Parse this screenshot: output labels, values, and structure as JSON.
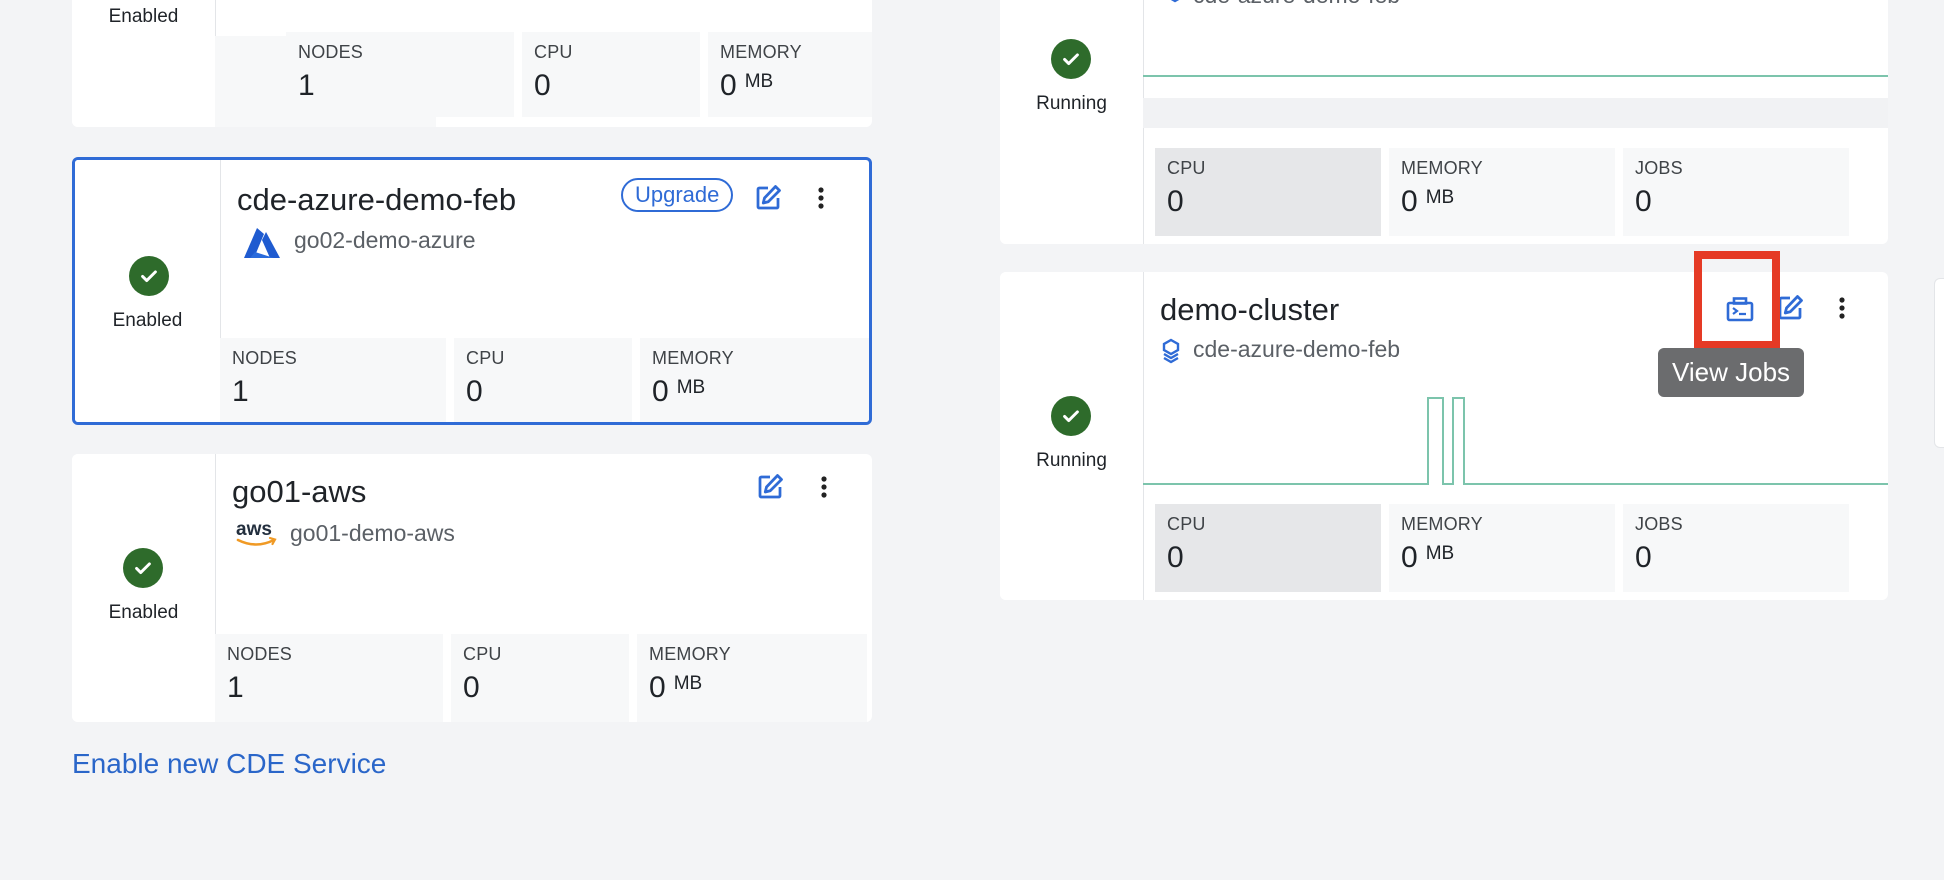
{
  "left_services": [
    {
      "status": "Enabled",
      "metrics": [
        {
          "label": "NODES",
          "value": "1",
          "unit": ""
        },
        {
          "label": "CPU",
          "value": "0",
          "unit": ""
        },
        {
          "label": "MEMORY",
          "value": "0",
          "unit": "MB"
        }
      ]
    },
    {
      "name": "cde-azure-demo-feb",
      "environment": "go02-demo-azure",
      "cloud_icon": "azure-icon",
      "status": "Enabled",
      "upgrade_label": "Upgrade",
      "metrics": [
        {
          "label": "NODES",
          "value": "1",
          "unit": ""
        },
        {
          "label": "CPU",
          "value": "0",
          "unit": ""
        },
        {
          "label": "MEMORY",
          "value": "0",
          "unit": "MB"
        }
      ]
    },
    {
      "name": "go01-aws",
      "environment": "go01-demo-aws",
      "cloud_icon": "aws-icon",
      "status": "Enabled",
      "metrics": [
        {
          "label": "NODES",
          "value": "1",
          "unit": ""
        },
        {
          "label": "CPU",
          "value": "0",
          "unit": ""
        },
        {
          "label": "MEMORY",
          "value": "0",
          "unit": "MB"
        }
      ]
    }
  ],
  "enable_link": "Enable new CDE Service",
  "right_clusters": [
    {
      "status": "Running",
      "service_partial": "cde-azure-demo-feb",
      "metrics": [
        {
          "label": "CPU",
          "value": "0",
          "unit": ""
        },
        {
          "label": "MEMORY",
          "value": "0",
          "unit": "MB"
        },
        {
          "label": "JOBS",
          "value": "0",
          "unit": ""
        }
      ]
    },
    {
      "name": "demo-cluster",
      "service": "cde-azure-demo-feb",
      "status": "Running",
      "tooltip": "View Jobs",
      "metrics": [
        {
          "label": "CPU",
          "value": "0",
          "unit": ""
        },
        {
          "label": "MEMORY",
          "value": "0",
          "unit": "MB"
        },
        {
          "label": "JOBS",
          "value": "0",
          "unit": ""
        }
      ]
    }
  ],
  "colors": {
    "accent": "#2f6bd6",
    "success": "#2e6b2b",
    "highlight": "#e53a25",
    "graph_line": "#7cc4ac"
  }
}
